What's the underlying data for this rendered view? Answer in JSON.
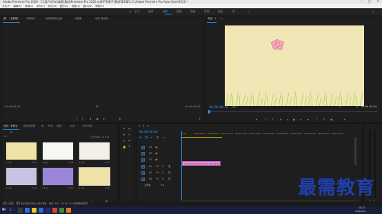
{
  "title_bar": {
    "text": "Adobe Premiere Pro 2020 - C:\\用户\\Chin\\桌面\\素材\\Premiere Pro 2020 从新手到高手\\素材\\第1章\\1.5 \\Adobe Premiere Pro Auto-Save\\2020 *",
    "minimize": "—",
    "maximize": "□",
    "close": "✕"
  },
  "menu": [
    "文件(F)",
    "编辑(E)",
    "剪辑(C)",
    "序列(S)",
    "标记(M)",
    "图形(G)",
    "视图(V)",
    "窗口(W)",
    "帮助(H)"
  ],
  "workspaces": [
    {
      "label": "学习"
    },
    {
      "label": "组件"
    },
    {
      "label": "编辑",
      "active": true
    },
    {
      "label": "颜色"
    },
    {
      "label": "效果"
    },
    {
      "label": "音频"
    },
    {
      "label": "图形"
    },
    {
      "label": "库"
    },
    {
      "label": "»"
    }
  ],
  "source_panel": {
    "tabs": [
      "源：（无剪辑）",
      "效果控件",
      "音频剪辑混合器：",
      "元数据",
      "音频 混合器：»"
    ],
    "timecode_left": "00;00;00;00",
    "timecode_right": "00;00;00;00"
  },
  "program_panel": {
    "tab": "节目：1",
    "tab_menu": "≡",
    "timecode": "00;00;00;00",
    "fit": "适合",
    "quality": "1/2",
    "duration": "00;00;39;20"
  },
  "project_panel": {
    "tabs": [
      "项目：未命名",
      "媒体浏览器",
      "库",
      "信息",
      "效果",
      "标记",
      "历史记录"
    ],
    "path": "lily",
    "count": "1 项已选择，共 6 项",
    "items": [
      {
        "name": "1.png",
        "duration": "4;29",
        "thumb": "#efe3a8"
      },
      {
        "name": "2.png",
        "duration": "4;29",
        "thumb": "#f7f7f3"
      },
      {
        "name": "3.png",
        "duration": "4;29",
        "thumb": "#f2f0e8"
      },
      {
        "name": "4.png",
        "duration": "4;29",
        "thumb": "#c9c2e3"
      },
      {
        "name": "5.png",
        "duration": "4;29",
        "thumb": "#9a86d9"
      },
      {
        "name": "6.png",
        "duration": "4;29",
        "thumb": "#efe3a8"
      }
    ]
  },
  "timeline": {
    "tab": "1",
    "tab_menu": "≡",
    "timecode": "00;00;00;00",
    "ruler": [
      "00;00",
      "00;00;04;00",
      "00;00;08;00",
      "00;00;12;00",
      "00;00;16;00",
      "00;00;20;00",
      "00;00;24;00",
      "00;00;28;00",
      "00;00;32;00",
      "00;00;36;00",
      "00;00;40;00",
      "00;00;44;00"
    ],
    "tracks": [
      {
        "id": "V3",
        "label": "V3"
      },
      {
        "id": "V2",
        "label": "V2"
      },
      {
        "id": "V1",
        "label": "V1"
      },
      {
        "id": "A1",
        "label": "A1"
      },
      {
        "id": "A2",
        "label": "A2"
      },
      {
        "id": "A3",
        "label": "A3"
      }
    ],
    "master": {
      "label": "主声道",
      "value": "0.0"
    },
    "clips": [
      "1.png",
      "2.png",
      "3.png",
      "4.png",
      "5.png",
      "6.png"
    ],
    "clip_color": "#e38fd8"
  },
  "status_bar": {
    "text": "单击以选择，或单击空白处并拖动以进行框选。使用 Shift、Alt 和 Ctrl 可获得其他选项。"
  },
  "taskbar": {
    "time": "15:27",
    "date": "2022/1/10"
  },
  "watermark": {
    "text": "最需教育"
  }
}
